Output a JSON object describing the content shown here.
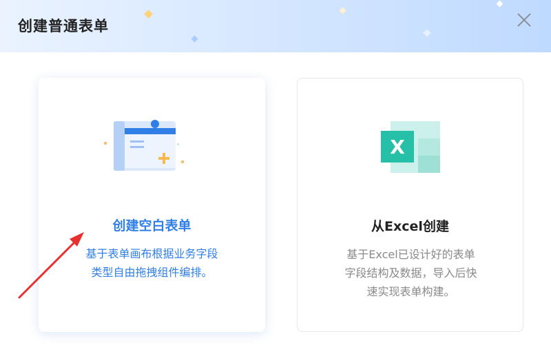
{
  "dialog": {
    "title": "创建普通表单",
    "close_icon": "close-icon"
  },
  "cards": {
    "blank": {
      "title": "创建空白表单",
      "desc_line1": "基于表单画布根据业务字段",
      "desc_line2": "类型自由拖拽组件编排。",
      "icon": "blank-form-icon",
      "accent": "#2f7fe6"
    },
    "excel": {
      "title": "从Excel创建",
      "desc_line1": "基于Excel已设计好的表单",
      "desc_line2": "字段结构及数据，导入后快",
      "desc_line3": "速实现表单构建。",
      "icon": "excel-icon",
      "icon_letter": "X",
      "accent": "#26bfa7"
    }
  },
  "annotation": {
    "arrow_color": "#e8312f"
  }
}
